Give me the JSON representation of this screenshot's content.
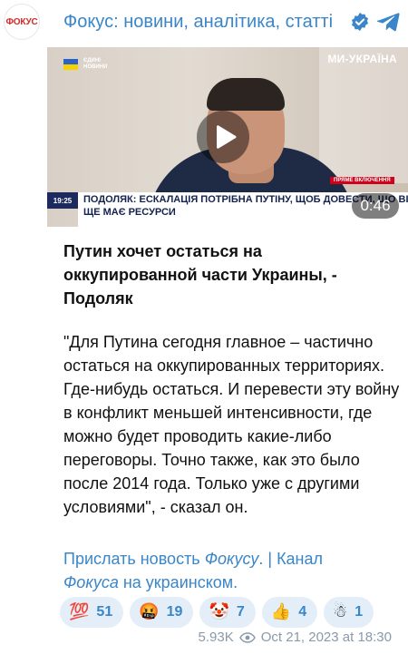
{
  "avatar": {
    "text": "ФОКУС"
  },
  "header": {
    "channel_name": "Фокус: новини, аналітика, статті"
  },
  "video": {
    "tv_logo": [
      "ЄДИНІ",
      "НОВИНИ"
    ],
    "channel_watermark": "МИ-УКРАЇНА",
    "live_badge": "ПРЯМЕ ВКЛЮЧЕННЯ",
    "time": "19:25",
    "lower_third_line1": "ПОДОЛЯК: ЕСКАЛАЦІЯ ПОТРІБНА ПУТІНУ, ЩОБ ДОВЕСТИ, ЩО ВІН",
    "lower_third_line2": "ЩЕ МАЄ РЕСУРСИ",
    "duration": "0:46"
  },
  "post": {
    "title": "Путин хочет остаться на оккупированной части Украины, - Подоляк",
    "body": "\"Для Путина сегодня главное – частично остаться на оккупированных территориях. Где-нибудь остаться. И перевести эту войну в конфликт меньшей интенсивности, где можно будет проводить какие-либо переговоры. Точно также, как это было после 2014 года. Только уже с другими условиями\", - сказал он.",
    "link1_prefix": "Прислать новость ",
    "link1_italic": "Фокусу",
    "link1_suffix": ".",
    "separator": "|",
    "link2_prefix": "Канал",
    "link2_italic": "Фокуса",
    "link2_suffix": " на украинском."
  },
  "reactions": [
    {
      "emoji": "💯",
      "count": "51",
      "icon": "hundred-points-icon"
    },
    {
      "emoji": "🤬",
      "count": "19",
      "icon": "cursing-face-icon"
    },
    {
      "emoji": "🤡",
      "count": "7",
      "icon": "clown-face-icon"
    },
    {
      "emoji": "👍",
      "count": "4",
      "icon": "thumbs-up-icon"
    },
    {
      "emoji": "☃",
      "count": "1",
      "icon": "snowman-icon"
    }
  ],
  "footer": {
    "views": "5.93K",
    "date": "Oct 21, 2023 at 18:30"
  },
  "colors": {
    "link": "#3a86c8",
    "reaction_bg": "#e3eef8",
    "meta": "#8a9aa8"
  }
}
